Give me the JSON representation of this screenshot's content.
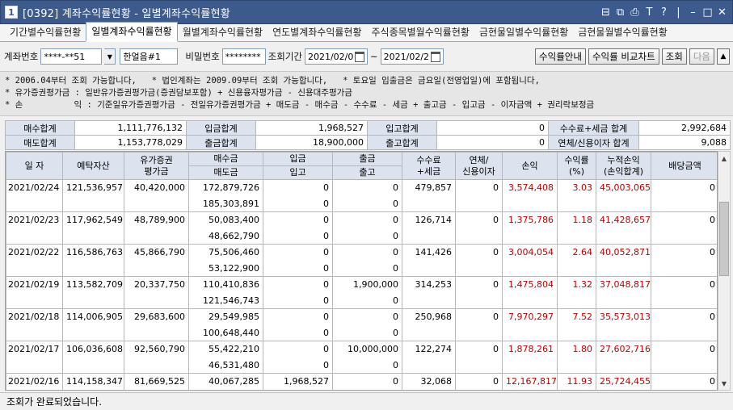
{
  "window": {
    "number": "1",
    "title": "[0392] 계좌수익률현황 - 일별계좌수익률현황"
  },
  "tabs": [
    {
      "label": "기간별수익률현황",
      "active": false
    },
    {
      "label": "일별계좌수익률현황",
      "active": true
    },
    {
      "label": "월별계좌수익률현황",
      "active": false
    },
    {
      "label": "연도별계좌수익률현황",
      "active": false
    },
    {
      "label": "주식종목별월수익률현황",
      "active": false
    },
    {
      "label": "금현물일별수익률현황",
      "active": false
    },
    {
      "label": "금현물월별수익률현황",
      "active": false
    }
  ],
  "toolbar": {
    "account_label": "계좌번호",
    "account_value": "****-**51",
    "account_name": "한얼음#1",
    "password_label": "비밀번호",
    "password_value": "********",
    "period_label": "조회기간",
    "date_from": "2021/02/0",
    "tilde": "~",
    "date_to": "2021/02/2",
    "btn_guide": "수익률안내",
    "btn_compare": "수익률 비교차트",
    "btn_search": "조회",
    "btn_next": "다음"
  },
  "notice": {
    "line1": "* 2006.04부터 조회 가능합니다,   * 법인계좌는 2009.09부터 조회 가능합니다,   * 토요일 입출금은 금요일(전영업일)에 포함됩니다,",
    "line2": "* 유가증권평가금 : 일반유가증권평가금(증권담보포함) + 신용융자평가금 - 신용대주평가금",
    "line3": "* 손          익 : 기준일유가증권평가금 - 전일유가증권평가금 + 매도금 - 매수금 - 수수료 - 세금 + 출고금 - 입고금 - 이자금액 + 권리락보정금"
  },
  "summary": {
    "buy_total_label": "매수합계",
    "buy_total": "1,111,776,132",
    "deposit_total_label": "입금합계",
    "deposit_total": "1,968,527",
    "in_total_label": "입고합계",
    "in_total": "0",
    "fee_tax_label": "수수료+세금 합계",
    "fee_tax": "2,992,684",
    "sell_total_label": "매도합계",
    "sell_total": "1,153,778,029",
    "withdraw_total_label": "출금합계",
    "withdraw_total": "18,900,000",
    "out_total_label": "출고합계",
    "out_total": "0",
    "interest_label": "연체/신용이자 합계",
    "interest": "9,088"
  },
  "grid": {
    "headers": {
      "date": "일 자",
      "deposit_asset": "예탁자산",
      "securities_eval": "유가증권\n평가금",
      "buy": "매수금",
      "sell": "매도금",
      "deposit": "입금",
      "in": "입고",
      "withdraw": "출금",
      "out": "출고",
      "fee_tax": "수수료\n+세금",
      "interest": "연체/\n신용이자",
      "pnl": "손익",
      "return": "수익률\n(%)",
      "cum_pnl": "누적손익\n(손익합계)",
      "dividend": "배당금액"
    },
    "rows": [
      {
        "date": "2021/02/24",
        "deposit_asset": "121,536,957",
        "securities_eval": "40,420,000",
        "buy": "172,879,726",
        "sell": "185,303,891",
        "deposit": "0",
        "in": "0",
        "withdraw": "0",
        "out": "0",
        "fee_tax": "479,857",
        "interest": "0",
        "pnl": "3,574,408",
        "return": "3.03",
        "cum_pnl": "45,003,065",
        "dividend": "0"
      },
      {
        "date": "2021/02/23",
        "deposit_asset": "117,962,549",
        "securities_eval": "48,789,900",
        "buy": "50,083,400",
        "sell": "48,662,790",
        "deposit": "0",
        "in": "0",
        "withdraw": "0",
        "out": "0",
        "fee_tax": "126,714",
        "interest": "0",
        "pnl": "1,375,786",
        "return": "1.18",
        "cum_pnl": "41,428,657",
        "dividend": "0"
      },
      {
        "date": "2021/02/22",
        "deposit_asset": "116,586,763",
        "securities_eval": "45,866,790",
        "buy": "75,506,460",
        "sell": "53,122,900",
        "deposit": "0",
        "in": "0",
        "withdraw": "0",
        "out": "0",
        "fee_tax": "141,426",
        "interest": "0",
        "pnl": "3,004,054",
        "return": "2.64",
        "cum_pnl": "40,052,871",
        "dividend": "0"
      },
      {
        "date": "2021/02/19",
        "deposit_asset": "113,582,709",
        "securities_eval": "20,337,750",
        "buy": "110,410,836",
        "sell": "121,546,743",
        "deposit": "0",
        "in": "0",
        "withdraw": "1,900,000",
        "out": "0",
        "fee_tax": "314,253",
        "interest": "0",
        "pnl": "1,475,804",
        "return": "1.32",
        "cum_pnl": "37,048,817",
        "dividend": "0"
      },
      {
        "date": "2021/02/18",
        "deposit_asset": "114,006,905",
        "securities_eval": "29,683,600",
        "buy": "29,549,985",
        "sell": "100,648,440",
        "deposit": "0",
        "in": "0",
        "withdraw": "0",
        "out": "0",
        "fee_tax": "250,968",
        "interest": "0",
        "pnl": "7,970,297",
        "return": "7.52",
        "cum_pnl": "35,573,013",
        "dividend": "0"
      },
      {
        "date": "2021/02/17",
        "deposit_asset": "106,036,608",
        "securities_eval": "92,560,790",
        "buy": "55,422,210",
        "sell": "46,531,480",
        "deposit": "0",
        "in": "0",
        "withdraw": "10,000,000",
        "out": "0",
        "fee_tax": "122,274",
        "interest": "0",
        "pnl": "1,878,261",
        "return": "1.80",
        "cum_pnl": "27,602,716",
        "dividend": "0"
      },
      {
        "date": "2021/02/16",
        "deposit_asset": "114,158,347",
        "securities_eval": "81,669,525",
        "buy": "40,067,285",
        "sell": "",
        "deposit": "1,968,527",
        "in": "",
        "withdraw": "0",
        "out": "",
        "fee_tax": "32,068",
        "interest": "0",
        "pnl": "12,167,817",
        "return": "11.93",
        "cum_pnl": "25,724,455",
        "dividend": "0"
      }
    ]
  },
  "status": {
    "message": "조회가 완료되었습니다."
  },
  "colors": {
    "title_bar": "#3c5a8c",
    "header_bg": "#dce3ee",
    "positive": "#c00000"
  }
}
